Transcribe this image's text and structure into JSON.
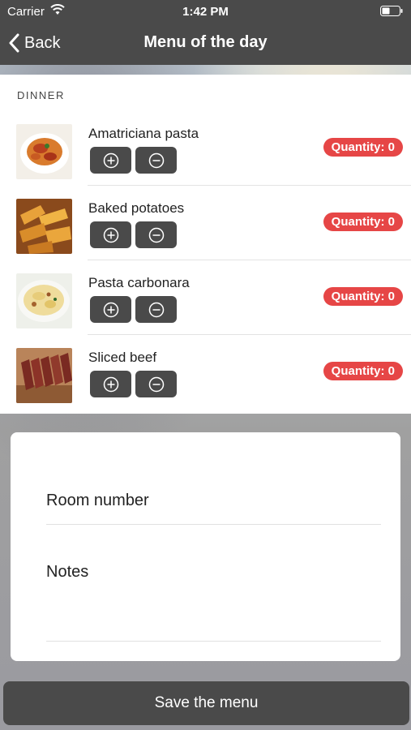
{
  "status_bar": {
    "carrier": "Carrier",
    "time": "1:42 PM",
    "wifi_icon": "wifi-icon",
    "battery_icon": "battery-icon"
  },
  "navbar": {
    "back_label": "Back",
    "back_icon": "chevron-left-icon",
    "title": "Menu of the day"
  },
  "menu": {
    "section_title": "DINNER",
    "items": [
      {
        "name": "Amatriciana pasta",
        "quantity_label": "Quantity: 0",
        "image": "amatriciana-pasta-photo"
      },
      {
        "name": "Baked potatoes",
        "quantity_label": "Quantity: 0",
        "image": "baked-potatoes-photo"
      },
      {
        "name": "Pasta carbonara",
        "quantity_label": "Quantity: 0",
        "image": "pasta-carbonara-photo"
      },
      {
        "name": "Sliced beef",
        "quantity_label": "Quantity: 0",
        "image": "sliced-beef-photo"
      }
    ],
    "plus_icon": "plus-circle-icon",
    "minus_icon": "minus-circle-icon"
  },
  "form": {
    "room_number_label": "Room number",
    "notes_label": "Notes"
  },
  "save_button_label": "Save the menu",
  "colors": {
    "bar_background": "#4a4a4a",
    "badge_red": "#e64646",
    "card_white": "#ffffff"
  }
}
